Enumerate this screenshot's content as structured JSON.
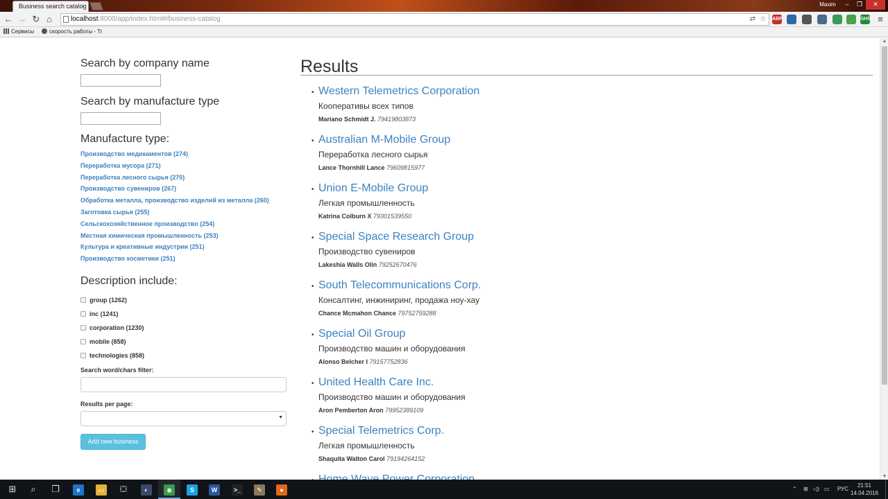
{
  "browser": {
    "tab_title": "Business search catalog",
    "tab_close": "×",
    "user_name": "Maxim",
    "url_host": "localhost",
    "url_rest": ":8000/app/index.html#/business-catalog",
    "bookmarks": [
      "Сервисы",
      "скорость работы - Tr"
    ],
    "extensions": [
      {
        "name": "abp",
        "label": "ABP",
        "color": "#c8302a"
      },
      {
        "name": "ext-blue",
        "label": "",
        "color": "#2a6aa8"
      },
      {
        "name": "ext-gear",
        "label": "",
        "color": "#555555"
      },
      {
        "name": "ext-shield",
        "label": "",
        "color": "#4a6a8a"
      },
      {
        "name": "ext-play",
        "label": "",
        "color": "#3a9a5a"
      },
      {
        "name": "ext-leaf",
        "label": "",
        "color": "#4aa24a"
      },
      {
        "name": "ext-green",
        "label": "GHS",
        "color": "#1e8a3a"
      },
      {
        "name": "ext-teal",
        "label": "",
        "color": "#2a9aa0"
      }
    ]
  },
  "sidebar": {
    "search_name_heading": "Search by company name",
    "search_type_heading": "Search by manufacture type",
    "manufacture_heading": "Manufacture type:",
    "manufacture_types": [
      "Производство медикаментов (274)",
      "Переработка мусора (271)",
      "Переработка лесного сырья (270)",
      "Производство сувениров (267)",
      "Обработка металла, производство изделий из металла (260)",
      "Заготовка сырья (255)",
      "Сельскохозяйственное производство (254)",
      "Местная химическая промышленность (253)",
      "Культура и креативные индустрии (251)",
      "Производство косметики (251)"
    ],
    "description_heading": "Description include:",
    "description_words": [
      "group (1262)",
      "inc (1241)",
      "corporation (1230)",
      "mobile (858)",
      "technologies (858)"
    ],
    "filter_label": "Search word/chars filter:",
    "filter_value": "",
    "per_page_label": "Results per page:",
    "per_page_value": "",
    "add_button": "Add new business"
  },
  "results": {
    "title": "Results",
    "items": [
      {
        "name": "Western Telemetrics Corporation",
        "type": "Кооперативы всех типов",
        "person": "Mariano Schmidt J.",
        "phone": "79419803873"
      },
      {
        "name": "Australian M-Mobile Group",
        "type": "Переработка лесного сырья",
        "person": "Lance Thornhill Lance",
        "phone": "79609815977"
      },
      {
        "name": "Union E-Mobile Group",
        "type": "Легкая промышленность",
        "person": "Katrina Colburn X",
        "phone": "79301539550"
      },
      {
        "name": "Special Space Research Group",
        "type": "Производство сувениров",
        "person": "Lakeshia Walls Olin",
        "phone": "79252670476"
      },
      {
        "name": "South Telecommunications Corp.",
        "type": "Консалтинг, инжиниринг, продажа ноу-хау",
        "person": "Chance Mcmahon Chance",
        "phone": "79752759288"
      },
      {
        "name": "Special Oil Group",
        "type": "Производство машин и оборудования",
        "person": "Alonso Belcher I",
        "phone": "79157752836"
      },
      {
        "name": "United Health Care Inc.",
        "type": "Производство машин и оборудования",
        "person": "Aron Pemberton Aron",
        "phone": "79952389109"
      },
      {
        "name": "Special Telemetrics Corp.",
        "type": "Легкая промышленность",
        "person": "Shaquita Walton Carol",
        "phone": "79194264152"
      },
      {
        "name": "Home Wave Power Corporation",
        "type": "",
        "person": "",
        "phone": ""
      }
    ]
  },
  "taskbar": {
    "apps": [
      {
        "name": "start",
        "glyph": "⊞",
        "color": ""
      },
      {
        "name": "search",
        "glyph": "⌕",
        "color": ""
      },
      {
        "name": "task-view",
        "glyph": "❐",
        "color": ""
      },
      {
        "name": "edge",
        "glyph": "e",
        "color": "#1d74c8"
      },
      {
        "name": "file-explorer",
        "glyph": "▭",
        "color": "#e2b23a"
      },
      {
        "name": "store",
        "glyph": "⛋",
        "color": ""
      },
      {
        "name": "steam",
        "glyph": "◐",
        "color": "#3a4a6a"
      },
      {
        "name": "chrome",
        "glyph": "◉",
        "color": "#3a9a4a"
      },
      {
        "name": "skype",
        "glyph": "S",
        "color": "#1ba1e2"
      },
      {
        "name": "word",
        "glyph": "W",
        "color": "#2b579a"
      },
      {
        "name": "terminal",
        "glyph": ">_",
        "color": "#222222"
      },
      {
        "name": "notepad",
        "glyph": "✎",
        "color": "#8a7a5a"
      },
      {
        "name": "firefox",
        "glyph": "●",
        "color": "#e06a1a"
      }
    ],
    "active_app": "chrome",
    "language": "РУС",
    "time": "21:51",
    "date": "14.04.2016"
  }
}
